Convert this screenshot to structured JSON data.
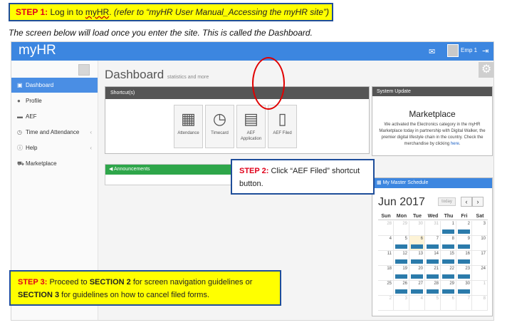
{
  "step1": {
    "label": "STEP 1:",
    "text_a": "Log in to",
    "app": "myHR",
    "text_b": ". ",
    "ref": "(refer to “myHR User Manual_Accessing the myHR site”)"
  },
  "intro": "The screen below will load once you enter the site. This is called the Dashboard.",
  "topbar": {
    "brand": "myHR",
    "mail_icon": "envelope-icon",
    "user_name": "Emp 1",
    "logout_icon": "sign-out-icon"
  },
  "sidebar": {
    "toggle_icon": "menu-toggle-icon",
    "items": [
      {
        "label": "Dashboard",
        "icon": "dashboard-icon",
        "active": true
      },
      {
        "label": "Profile",
        "icon": "user-icon"
      },
      {
        "label": "AEF",
        "icon": "folder-icon"
      },
      {
        "label": "Time and Attendance",
        "icon": "clock-icon",
        "chevron": "‹"
      },
      {
        "label": "Help",
        "icon": "info-icon",
        "chevron": "‹"
      },
      {
        "label": "Marketplace",
        "icon": "cart-icon"
      }
    ]
  },
  "main": {
    "title": "Dashboard",
    "subtitle": "statistics and more"
  },
  "shortcuts": {
    "title": "Shortcut(s)",
    "items": [
      {
        "label": "Attendance",
        "icon": "calendar-icon"
      },
      {
        "label": "Timecard",
        "icon": "clock-icon"
      },
      {
        "label": "AEF Application",
        "icon": "document-icon"
      },
      {
        "label": "AEF Filed",
        "icon": "file-icon"
      }
    ]
  },
  "announcements": {
    "title": "Announcements"
  },
  "system_update": {
    "title": "System Update",
    "heading": "Marketplace",
    "body": "We activated the Electronics category in the myHR Marketplace today in partnership with Digital Walker, the premier digital lifestyle chain in the country. Check the merchandise by clicking",
    "link": "here",
    "after_link": "."
  },
  "schedule": {
    "title": "My Master Schedule",
    "month": "Jun 2017",
    "today_label": "today",
    "prev": "‹",
    "next": "›",
    "weekdays": [
      "Sun",
      "Mon",
      "Tue",
      "Wed",
      "Thu",
      "Fri",
      "Sat"
    ],
    "days": [
      {
        "n": "28",
        "o": true
      },
      {
        "n": "29",
        "o": true
      },
      {
        "n": "30",
        "o": true
      },
      {
        "n": "31",
        "o": true
      },
      {
        "n": "1",
        "e": true
      },
      {
        "n": "2",
        "e": true
      },
      {
        "n": "3"
      },
      {
        "n": "4"
      },
      {
        "n": "5",
        "e": true
      },
      {
        "n": "6",
        "e": true,
        "t": true
      },
      {
        "n": "7",
        "e": true
      },
      {
        "n": "8",
        "e": true
      },
      {
        "n": "9",
        "e": true
      },
      {
        "n": "10"
      },
      {
        "n": "11"
      },
      {
        "n": "12",
        "e": true
      },
      {
        "n": "13",
        "e": true
      },
      {
        "n": "14",
        "e": true
      },
      {
        "n": "15",
        "e": true
      },
      {
        "n": "16",
        "e": true
      },
      {
        "n": "17"
      },
      {
        "n": "18"
      },
      {
        "n": "19",
        "e": true
      },
      {
        "n": "20",
        "e": true
      },
      {
        "n": "21",
        "e": true
      },
      {
        "n": "22",
        "e": true
      },
      {
        "n": "23",
        "e": true
      },
      {
        "n": "24"
      },
      {
        "n": "25"
      },
      {
        "n": "26",
        "e": true
      },
      {
        "n": "27",
        "e": true
      },
      {
        "n": "28",
        "e": true
      },
      {
        "n": "29",
        "e": true
      },
      {
        "n": "30",
        "e": true
      },
      {
        "n": "1",
        "o": true
      },
      {
        "n": "2",
        "o": true
      },
      {
        "n": "3",
        "o": true
      },
      {
        "n": "4",
        "o": true
      },
      {
        "n": "5",
        "o": true
      },
      {
        "n": "6",
        "o": true
      },
      {
        "n": "7",
        "o": true
      },
      {
        "n": "8",
        "o": true
      }
    ]
  },
  "step2": {
    "label": "STEP 2:",
    "text": "Click “AEF Filed” shortcut button."
  },
  "step3": {
    "label": "STEP 3:",
    "t1": "Proceed to",
    "s2": "SECTION 2",
    "t2": "for screen navigation guidelines or",
    "s3": "SECTION 3",
    "t3": "for guidelines on how to cancel filed forms."
  },
  "colors": {
    "topbar": "#3c86e0",
    "active_nav": "#4a8ee4",
    "callout_yellow": "#ffff00",
    "callout_border": "#1f4e9a",
    "step_red": "#e0001a",
    "announce_green": "#2ea64a",
    "event_blue": "#2b7bab"
  }
}
